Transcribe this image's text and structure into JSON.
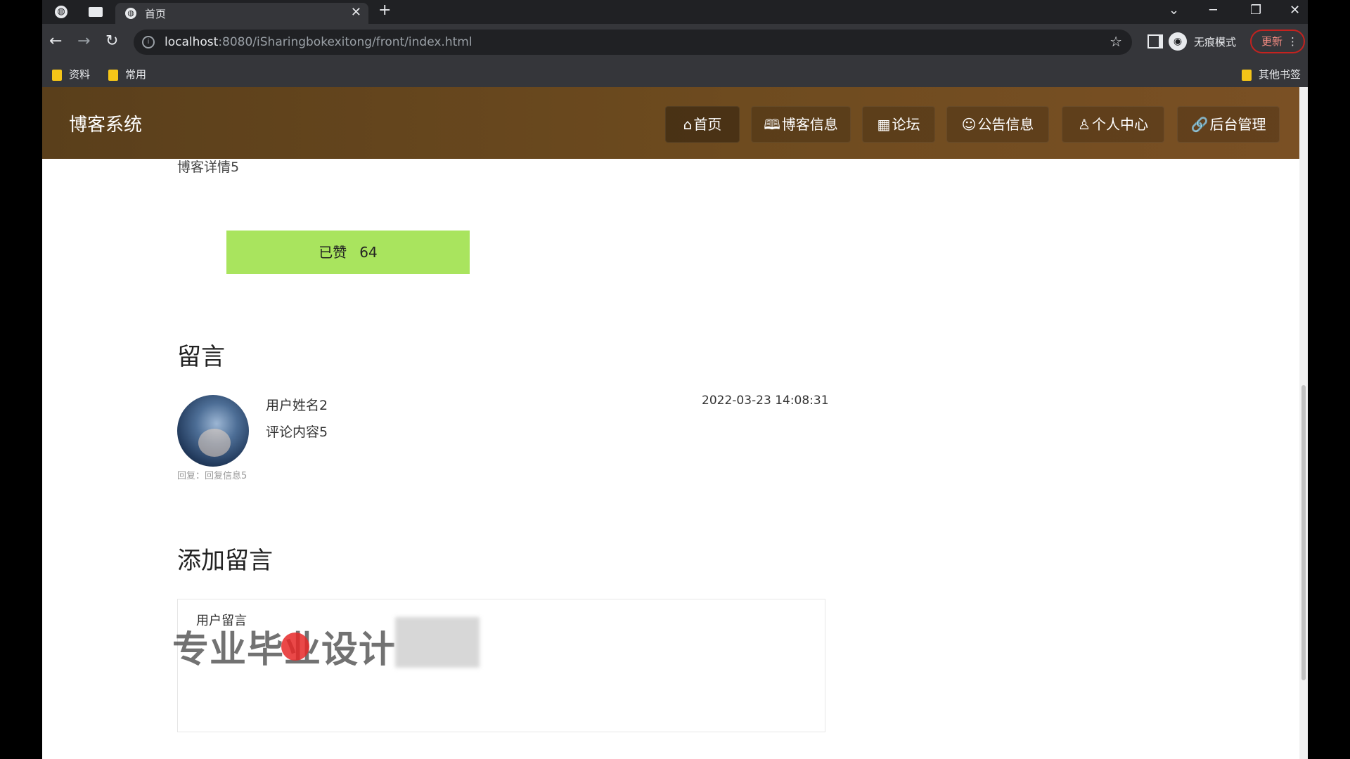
{
  "browser": {
    "tab_title": "首页",
    "tab_close": "✕",
    "new_tab": "+",
    "url_host": "localhost",
    "url_rest": ":8080/iSharingbokexitong/front/index.html",
    "incognito_label": "无痕模式",
    "update_label": "更新",
    "update_menu": "⋮",
    "bookmarks": [
      "资料",
      "常用"
    ],
    "other_bookmarks": "其他书签",
    "nav_back": "←",
    "nav_forward": "→",
    "nav_reload": "↻",
    "star": "☆",
    "win_minimize": "─",
    "win_restore": "❐",
    "win_close": "✕",
    "tab_search": "⌄"
  },
  "site": {
    "title": "博客系统",
    "nav": [
      {
        "icon": "⌂",
        "label": "首页"
      },
      {
        "icon": "🕮",
        "label": "博客信息"
      },
      {
        "icon": "▦",
        "label": "论坛"
      },
      {
        "icon": "☺",
        "label": "公告信息"
      },
      {
        "icon": "♙",
        "label": "个人中心"
      },
      {
        "icon": "🔗",
        "label": "后台管理"
      }
    ]
  },
  "detail": {
    "title": "博客详情5",
    "like_label": "已赞",
    "like_count": "64"
  },
  "comments": {
    "heading": "留言",
    "items": [
      {
        "username": "用户姓名2",
        "content": "评论内容5",
        "time": "2022-03-23 14:08:31",
        "reply": "回复：回复信息5"
      }
    ]
  },
  "add_message": {
    "heading": "添加留言",
    "field_label": "用户留言",
    "value": ""
  },
  "overlay": {
    "watermark": "专业毕业设计"
  },
  "icons": {
    "info": "info-icon",
    "incognito": "incognito-icon",
    "folder": "folder-icon"
  }
}
